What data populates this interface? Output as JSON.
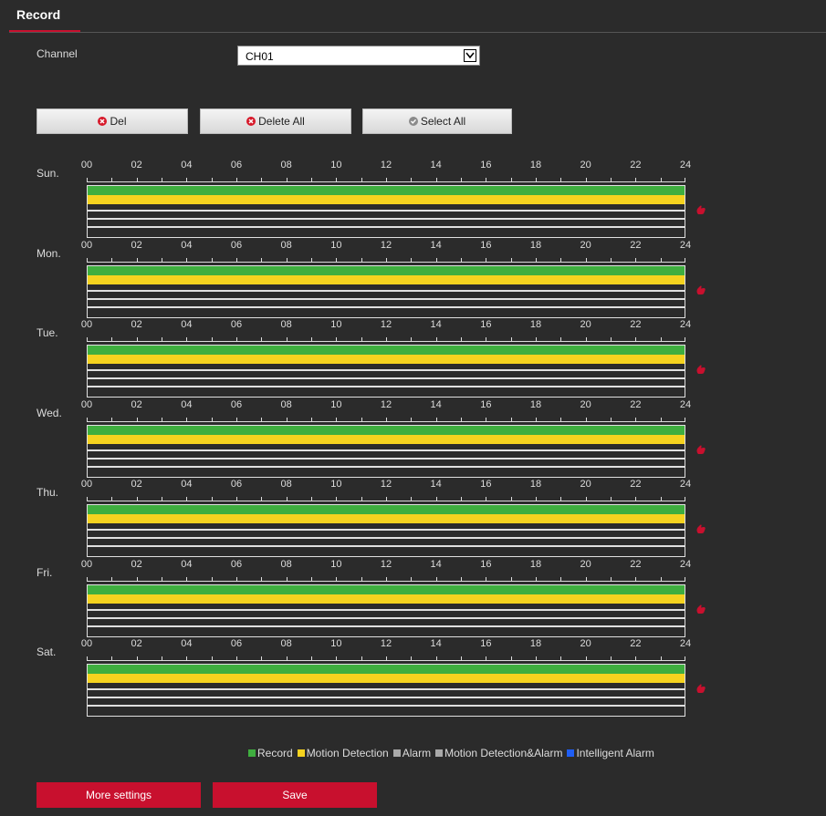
{
  "tab": {
    "title": "Record"
  },
  "channel": {
    "label": "Channel",
    "value": "CH01"
  },
  "buttons": {
    "del": "Del",
    "delete_all": "Delete All",
    "select_all": "Select All",
    "more_settings": "More settings",
    "save": "Save"
  },
  "hours": [
    "00",
    "02",
    "04",
    "06",
    "08",
    "10",
    "12",
    "14",
    "16",
    "18",
    "20",
    "22",
    "24"
  ],
  "days": [
    {
      "label": "Sun.",
      "record": [
        0,
        24
      ],
      "motion": [
        0,
        24
      ]
    },
    {
      "label": "Mon.",
      "record": [
        0,
        24
      ],
      "motion": [
        0,
        24
      ]
    },
    {
      "label": "Tue.",
      "record": [
        0,
        24
      ],
      "motion": [
        0,
        24
      ]
    },
    {
      "label": "Wed.",
      "record": [
        0,
        24
      ],
      "motion": [
        0,
        24
      ]
    },
    {
      "label": "Thu.",
      "record": [
        0,
        24
      ],
      "motion": [
        0,
        24
      ]
    },
    {
      "label": "Fri.",
      "record": [
        0,
        24
      ],
      "motion": [
        0,
        24
      ]
    },
    {
      "label": "Sat.",
      "record": [
        0,
        24
      ],
      "motion": [
        0,
        24
      ]
    }
  ],
  "legend": [
    {
      "label": "Record",
      "color": "#3fae3f"
    },
    {
      "label": "Motion Detection",
      "color": "#f5d31f"
    },
    {
      "label": "Alarm",
      "color": "#a9a9a9"
    },
    {
      "label": "Motion Detection&Alarm",
      "color": "#a9a9a9"
    },
    {
      "label": "Intelligent Alarm",
      "color": "#1f5ef5"
    }
  ],
  "colors": {
    "accent": "#c8102e",
    "record": "#3fae3f",
    "motion": "#f5d31f"
  }
}
